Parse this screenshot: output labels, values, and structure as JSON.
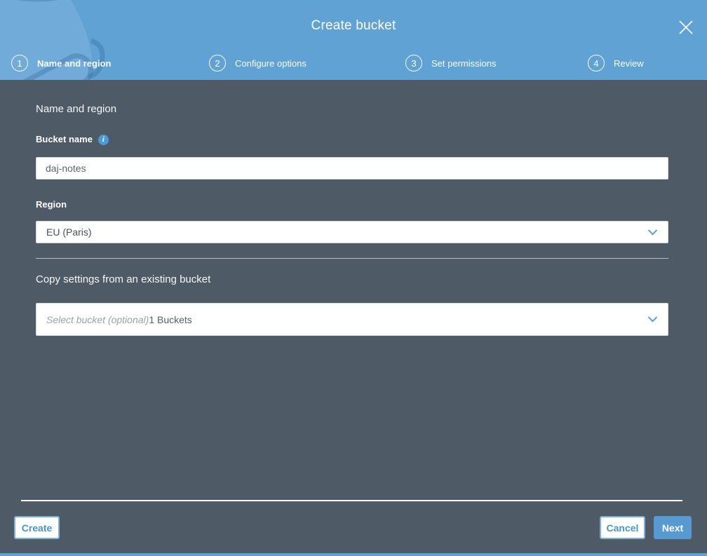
{
  "header": {
    "title": "Create bucket"
  },
  "steps": [
    {
      "number": "1",
      "label": "Name and region",
      "active": true
    },
    {
      "number": "2",
      "label": "Configure options",
      "active": false
    },
    {
      "number": "3",
      "label": "Set permissions",
      "active": false
    },
    {
      "number": "4",
      "label": "Review",
      "active": false
    }
  ],
  "form": {
    "section_title": "Name and region",
    "bucket_name": {
      "label": "Bucket name",
      "value": "daj-notes"
    },
    "region": {
      "label": "Region",
      "selected": "EU (Paris)"
    },
    "copy_section_title": "Copy settings from an existing bucket",
    "bucket_select": {
      "placeholder": "Select bucket (optional)",
      "suffix": "1 Buckets"
    }
  },
  "footer": {
    "create_label": "Create",
    "cancel_label": "Cancel",
    "next_label": "Next"
  },
  "icons": {
    "info": "i"
  },
  "colors": {
    "header_blue": "#61a2d5",
    "body_bg": "#4e5b66",
    "accent_blue": "#4a94cf",
    "next_button_bg": "#579ad2"
  }
}
